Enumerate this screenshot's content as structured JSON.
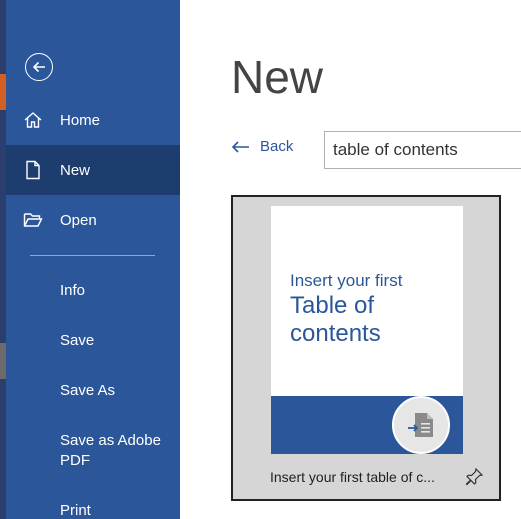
{
  "sidebar": {
    "nav": [
      {
        "label": "Home",
        "icon": "home-icon"
      },
      {
        "label": "New",
        "icon": "new-document-icon"
      },
      {
        "label": "Open",
        "icon": "open-folder-icon"
      }
    ],
    "items": [
      "Info",
      "Save",
      "Save As",
      "Save as Adobe PDF",
      "Print"
    ]
  },
  "page": {
    "title": "New",
    "back_label": "Back"
  },
  "search": {
    "value": "table of contents"
  },
  "template": {
    "thumb_line1": "Insert your first",
    "thumb_line2": "Table of",
    "thumb_line3": "contents",
    "label": "Insert your first table of c...",
    "pin_icon": "pin-icon"
  },
  "colors": {
    "sidebar": "#2b579a",
    "sidebar_active": "#1d3d6e",
    "accent": "#2b579a"
  }
}
